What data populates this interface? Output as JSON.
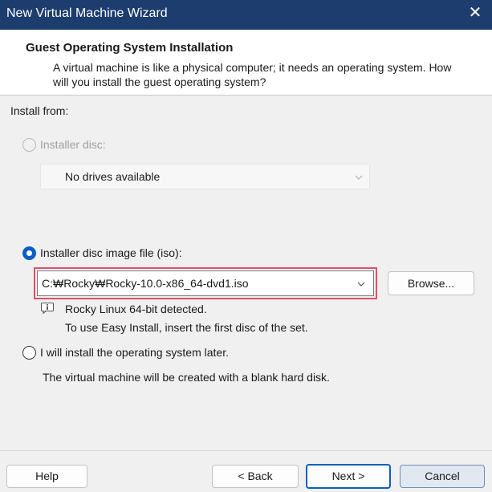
{
  "window": {
    "title": "New Virtual Machine Wizard",
    "close_glyph": "✕"
  },
  "header": {
    "title": "Guest Operating System Installation",
    "description": "A virtual machine is like a physical computer; it needs an operating system. How will you install the guest operating system?"
  },
  "install_from": {
    "label": "Install from:",
    "installer_disc": {
      "label": "Installer disc:",
      "selected": false,
      "enabled": false,
      "dropdown_value": "No drives available"
    },
    "iso": {
      "label": "Installer disc image file (iso):",
      "selected": true,
      "path": "C:₩Rocky₩Rocky-10.0-x86_64-dvd1.iso",
      "browse_label": "Browse...",
      "detected_text": "Rocky Linux 64-bit detected.",
      "hint_text": "To use Easy Install, insert the first disc of the set.",
      "highlight_color": "#e0506a"
    },
    "later": {
      "label": "I will install the operating system later.",
      "selected": false,
      "description": "The virtual machine will be created with a blank hard disk."
    }
  },
  "footer": {
    "help_label": "Help",
    "back_label": "< Back",
    "next_label": "Next >",
    "cancel_label": "Cancel"
  },
  "colors": {
    "titlebar": "#1c3d6e",
    "accent": "#0a5fc0"
  },
  "icons": {
    "info": "info-icon",
    "chevron": "chevron-down-icon",
    "close": "close-icon"
  }
}
